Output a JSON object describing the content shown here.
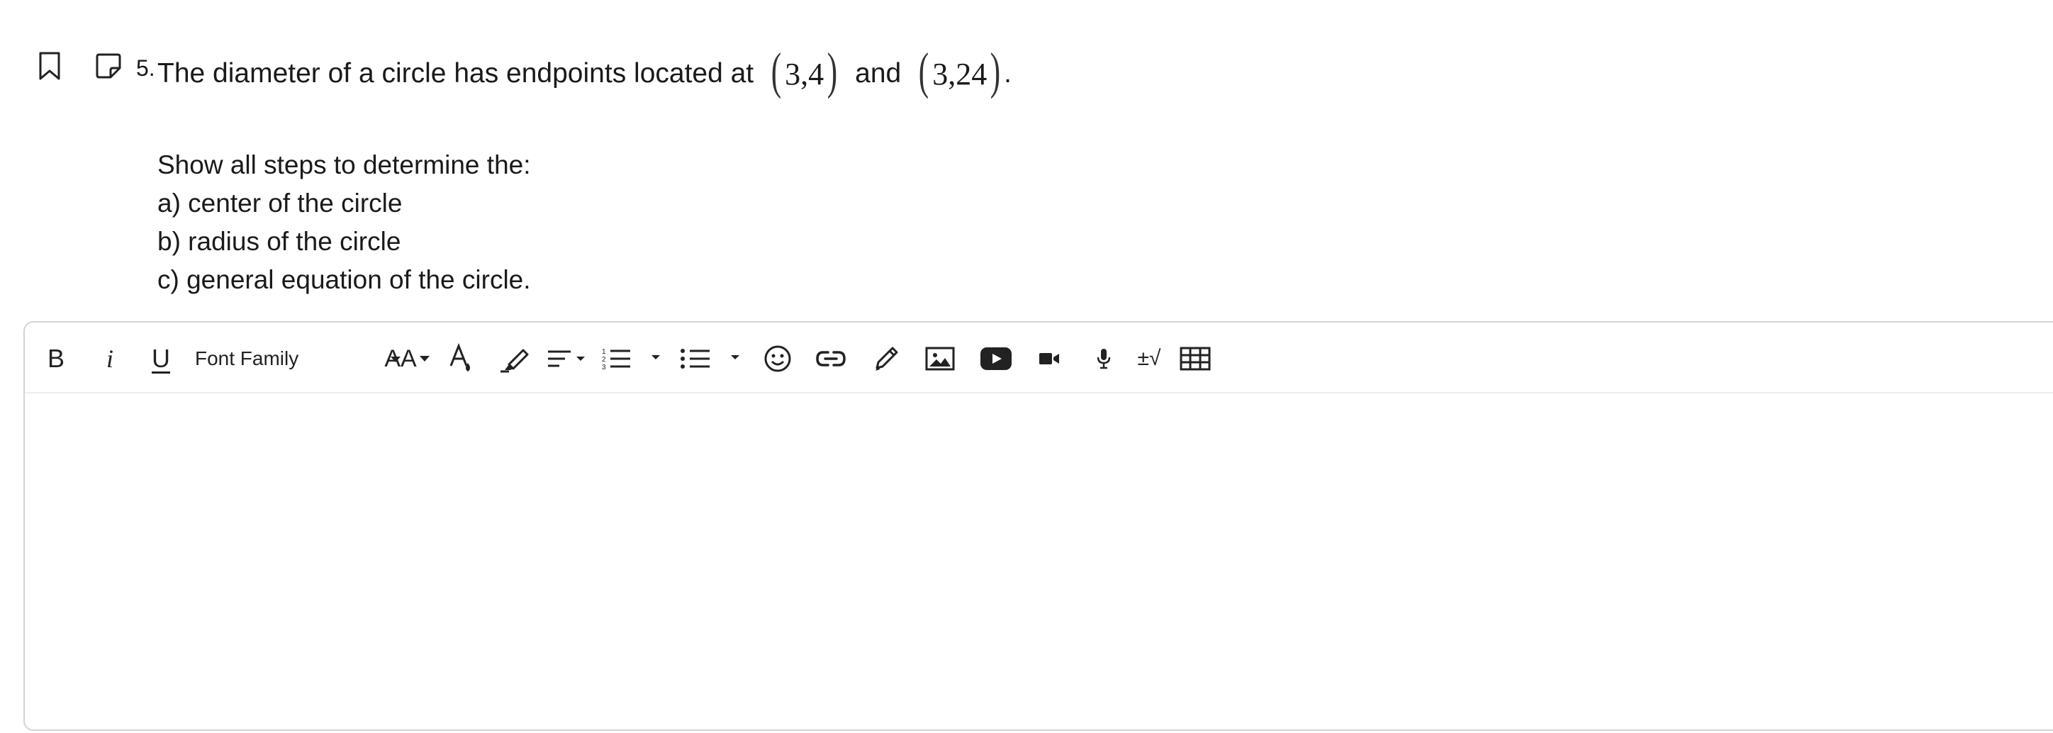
{
  "question": {
    "number": "5.",
    "text_before": "The diameter of a circle has endpoints located at",
    "point1": "3,4",
    "and_text": "and",
    "point2": "3,24",
    "period": "."
  },
  "prompt_lines": [
    "Show all steps to determine the:",
    "a) center of the circle",
    "b) radius of the circle",
    "c) general equation of the circle."
  ],
  "toolbar": {
    "bold_label": "B",
    "italic_label": "i",
    "underline_label": "U",
    "font_family_label": "Font Family",
    "font_size_label": "AA",
    "math_label": "±√"
  },
  "icons": [
    "bookmark-icon",
    "note-icon",
    "text-color-icon",
    "highlighter-icon",
    "align-icon",
    "numbered-list-icon",
    "bullet-list-icon",
    "emoji-icon",
    "link-icon",
    "pencil-icon",
    "image-icon",
    "youtube-icon",
    "video-icon",
    "microphone-icon",
    "table-icon"
  ]
}
